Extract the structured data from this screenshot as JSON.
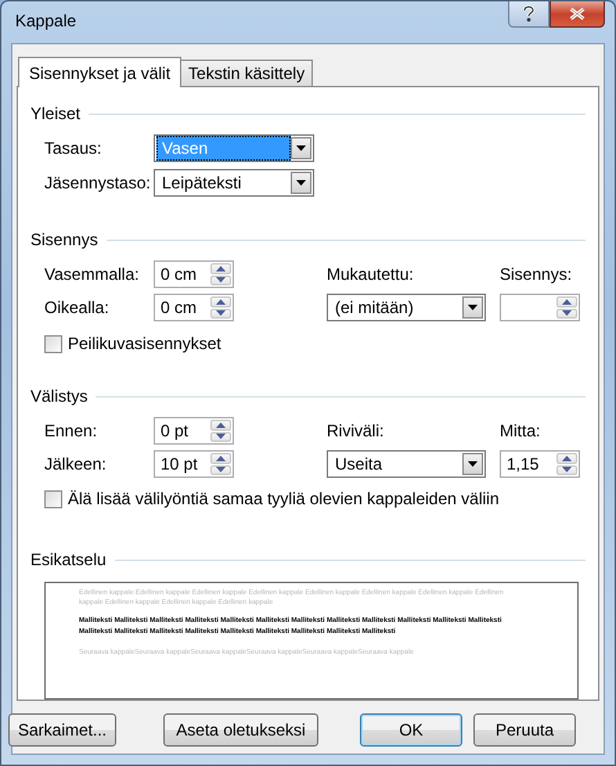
{
  "window": {
    "title": "Kappale"
  },
  "tabs": [
    {
      "label": "Sisennykset ja välit",
      "selected": true
    },
    {
      "label": "Tekstin käsittely",
      "selected": false
    }
  ],
  "general": {
    "title": "Yleiset",
    "alignment": {
      "label": "Tasaus:",
      "value": "Vasen",
      "focused": true
    },
    "outline_level": {
      "label": "Jäsennystaso:",
      "value": "Leipäteksti",
      "focused": false
    }
  },
  "indentation": {
    "title": "Sisennys",
    "left": {
      "label": "Vasemmalla:",
      "value": "0 cm"
    },
    "right": {
      "label": "Oikealla:",
      "value": "0 cm"
    },
    "special": {
      "label": "Mukautettu:",
      "value": "(ei mitään)"
    },
    "by": {
      "label": "Sisennys:"
    },
    "mirror_indents": {
      "label": "Peilikuvasisennykset",
      "checked": false
    }
  },
  "spacing": {
    "title": "Välistys",
    "before": {
      "label": "Ennen:",
      "value": "0 pt"
    },
    "after": {
      "label": "Jälkeen:",
      "value": "10 pt"
    },
    "line_spacing": {
      "label": "Riviväli:",
      "value": "Useita"
    },
    "at": {
      "label": "Mitta:",
      "value": "1,15"
    },
    "dont_add_space": {
      "label": "Älä lisää välilyöntiä samaa tyyliä olevien kappaleiden väliin",
      "checked": false
    }
  },
  "preview": {
    "title": "Esikatselu",
    "previous": "Edellinen kappale Edellinen kappale Edellinen kappale Edellinen kappale Edellinen kappale Edellinen kappale Edellinen kappale Edellinen kappale Edellinen kappale Edellinen kappale Edellinen kappale",
    "sample": "Malliteksti Malliteksti Malliteksti Malliteksti Malliteksti Malliteksti Malliteksti Malliteksti Malliteksti Malliteksti Malliteksti Malliteksti Malliteksti Malliteksti Malliteksti Malliteksti Malliteksti Malliteksti Malliteksti Malliteksti Malliteksti",
    "next": "Seuraava kappaleSeuraava kappaleSeuraava kappaleSeuraava kappaleSeuraava kappaleSeuraava kappale"
  },
  "buttons": [
    {
      "label": "Sarkaimet...",
      "default": false
    },
    {
      "label": "Aseta oletukseksi",
      "default": false
    },
    {
      "label": "OK",
      "default": true
    },
    {
      "label": "Peruuta",
      "default": false
    }
  ]
}
